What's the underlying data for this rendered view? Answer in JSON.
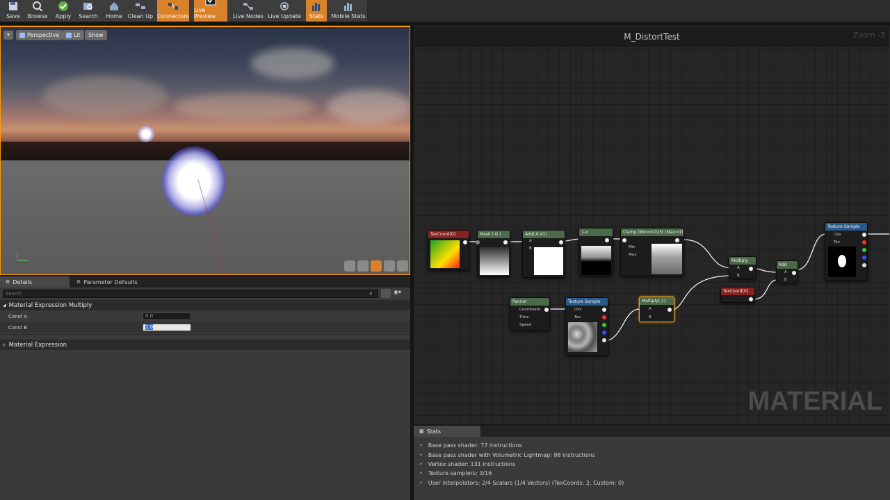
{
  "toolbar": {
    "buttons": [
      {
        "label": "Save",
        "icon": "save-icon",
        "active": false
      },
      {
        "label": "Browse",
        "icon": "browse-icon",
        "active": false
      },
      {
        "label": "Apply",
        "icon": "apply-check-icon",
        "active": false
      },
      {
        "label": "Search",
        "icon": "search-icon",
        "active": false
      },
      {
        "label": "Home",
        "icon": "home-icon",
        "active": false
      },
      {
        "label": "Clean Up",
        "icon": "cleanup-icon",
        "active": false
      },
      {
        "label": "Connectors",
        "icon": "connectors-icon",
        "active": true
      },
      {
        "label": "Live Preview",
        "icon": "live-preview-icon",
        "active": true
      },
      {
        "label": "Live Nodes",
        "icon": "live-nodes-icon",
        "active": false
      },
      {
        "label": "Live Update",
        "icon": "live-update-icon",
        "active": false
      },
      {
        "label": "Stats",
        "icon": "stats-icon",
        "active": true
      },
      {
        "label": "Mobile Stats",
        "icon": "mobile-stats-icon",
        "active": false
      }
    ],
    "accent": "#d9822b"
  },
  "viewport": {
    "view_mode": "Perspective",
    "lighting": "Lit",
    "show": "Show"
  },
  "details": {
    "tabs": [
      {
        "label": "Details",
        "active": true
      },
      {
        "label": "Parameter Defaults",
        "active": false
      }
    ],
    "search_placeholder": "Search",
    "category_main": "Material Expression Multiply",
    "props": [
      {
        "label": "Const A",
        "value": "0.0"
      },
      {
        "label": "Const B",
        "value": "1.0"
      }
    ],
    "category_sub": "Material Expression"
  },
  "graph": {
    "title": "M_DistortTest",
    "zoom": "Zoom -3",
    "watermark": "MATERIAL",
    "nodes": {
      "texcoord1": "TexCoord[0]",
      "mask": "Mask ( G )",
      "add1": "Add(,0.41)",
      "oneminus": "1-x",
      "clamp": "Clamp (Min=0.025) (Max=1)",
      "clamp_min": "Min",
      "clamp_max": "Max",
      "multiply1": "Multiply",
      "add2": "Add",
      "texsample1": "Texture Sample",
      "texsample1_uvs": "UVs",
      "texsample1_tex": "Tex",
      "texcoord2": "TexCoord[0]",
      "panner": "Panner",
      "panner_coord": "Coordinate",
      "panner_time": "Time",
      "panner_speed": "Speed",
      "texsample2": "Texture Sample",
      "texsample2_uvs": "UVs",
      "texsample2_tex": "Tex",
      "multiply2": "Multiply(,1)",
      "pin_a": "A",
      "pin_b": "B"
    }
  },
  "stats": {
    "tab": "Stats",
    "lines": [
      "Base pass shader: 77 instructions",
      "Base pass shader with Volumetric Lightmap: 98 instructions",
      "Vertex shader: 131 instructions",
      "Texture samplers: 3/16",
      "User interpolators: 2/4 Scalars (1/4 Vectors) (TexCoords: 2, Custom: 0)"
    ]
  }
}
